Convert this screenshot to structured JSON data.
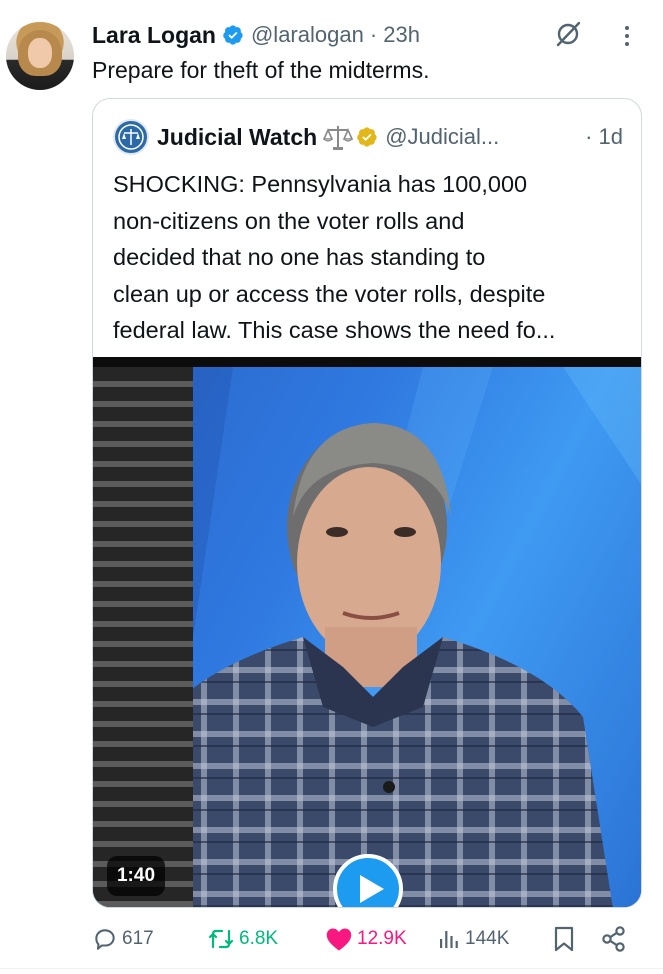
{
  "author": {
    "name": "Lara Logan",
    "handle": "@laralogan",
    "time": "· 23h",
    "text": "Prepare for theft of the midterms."
  },
  "quoted": {
    "name": "Judicial Watch",
    "handle": "@Judicial...",
    "time": "· 1d",
    "text_lines": [
      "SHOCKING: Pennsylvania has 100,000",
      "non-citizens on the voter rolls and",
      "decided that no one has standing to",
      "clean up or access the voter rolls, despite",
      "federal law. This case shows the need fo..."
    ],
    "video": {
      "duration": "1:40"
    }
  },
  "actions": {
    "replies": "617",
    "reposts": "6.8K",
    "likes": "12.9K",
    "views": "144K"
  },
  "colors": {
    "verified_blue": "#1d9bf0",
    "org_gold": "#e2b719",
    "retweet_green": "#00ba7c",
    "like_pink": "#f91880",
    "muted_gray": "#536471"
  },
  "icons": [
    "verified-badge-icon",
    "grok-icon",
    "more-icon",
    "scales-icon",
    "org-badge-icon",
    "play-icon",
    "reply-icon",
    "retweet-icon",
    "like-icon",
    "views-icon",
    "bookmark-icon",
    "share-icon"
  ]
}
